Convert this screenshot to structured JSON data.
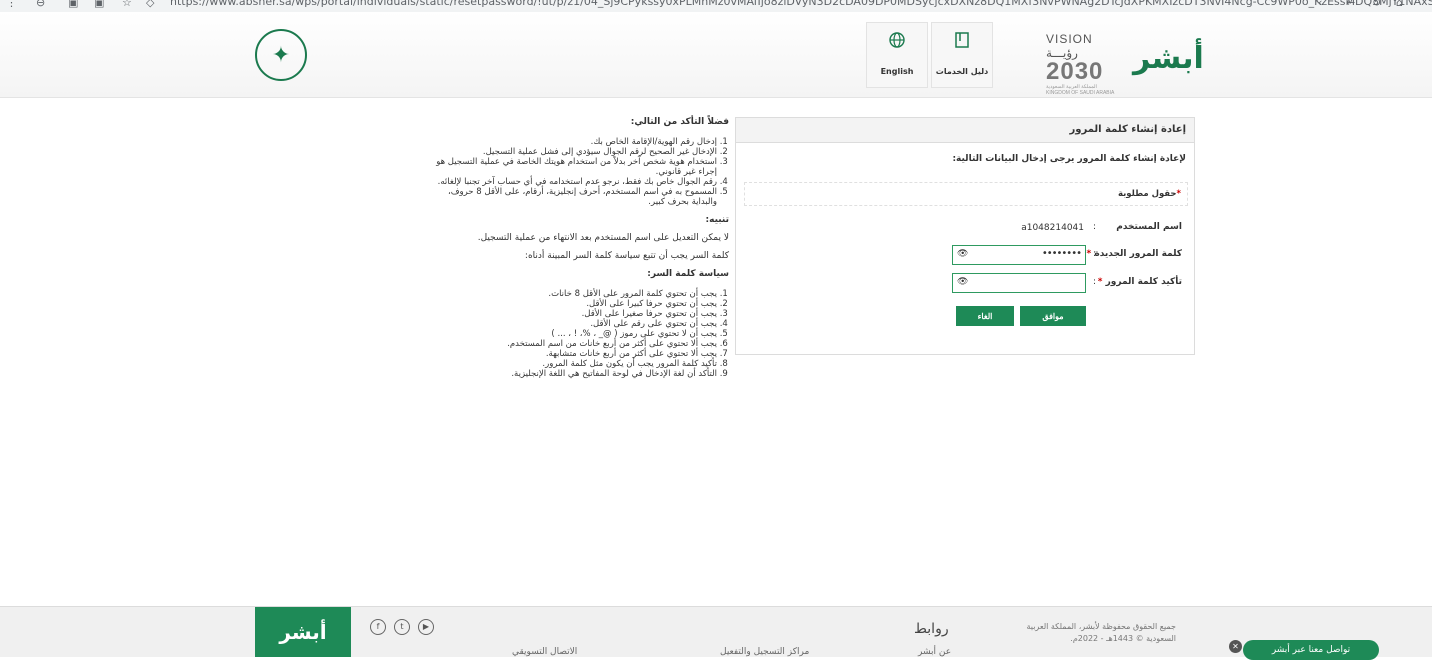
{
  "browser": {
    "url": "https://www.absher.sa/wps/portal/individuals/static/resetpassword/!ut/p/z1/04_Sj9CPykssy0xPLMnMz0vMAfIjo8ziDVyN3D2cDA09DP0MDSycjcxDXNz8DQ1MXf3NvPWNAg2DTcJdXPKMXIzcDT3NvI4Ncg-Cc9WP0o_KzEssMDQ3MjY1NAxSSC4tIk-H2CVBgxw2LqQJvH4Wkmy1Wa/"
  },
  "header": {
    "tiles": [
      {
        "label": "دليل الخدمات",
        "icon": "book-icon"
      },
      {
        "label": "English",
        "icon": "globe-icon"
      }
    ],
    "vision": {
      "line1": "VISION رؤيـــة",
      "year": "2030",
      "sub1": "المملكة العربية السعودية",
      "sub2": "KINGDOM OF SAUDI ARABIA"
    },
    "brand": "أبشر"
  },
  "form": {
    "title": "إعادة إنشاء كلمة المرور",
    "intro": "لإعادة إنشاء كلمة المرور يرجى إدخال البيانات التالية:",
    "required_note": "حقول مطلوبة",
    "username_label": "اسم المستخدم",
    "username_value": "a1048214041",
    "new_password_label": "كلمة المرور الجديدة",
    "new_password_value": "••••••••",
    "confirm_password_label": "تأكيد كلمة المرور",
    "confirm_password_value": "",
    "colon": ":",
    "star": "*",
    "ok_button": "موافق",
    "cancel_button": "الغاء"
  },
  "instructions": {
    "check_title": "فضلاً التأكد من التالي:",
    "check_items": [
      "إدخال رقم الهوية/الإقامة الخاص بك.",
      "الإدخال غير الصحيح لرقم الجوال سيؤدي إلى فشل عملية التسجيل.",
      "استخدام هوية شخص آخر بدلاً من استخدام هويتك الخاصة في عملية التسجيل هو إجراء غير قانوني.",
      "رقم الجوال خاص بك فقط، نرجو عدم استخدامه في أي حساب آخر تجنبا لإلغائه.",
      "المسموح به في اسم المستخدم، أحرف إنجليزية، أرقام، على الأقل 8 حروف، والبداية بحرف كبير."
    ],
    "note_title": "تنبيه:",
    "note_text1": "لا يمكن التعديل على اسم المستخدم بعد الانتهاء من عملية التسجيل.",
    "note_text2": "كلمة السر يجب أن تتبع سياسة كلمة السر المبينة أدناه:",
    "policy_title": "سياسة كلمة السر:",
    "policy_items": [
      "يجب أن تحتوي كلمة المرور على الأقل 8 خانات.",
      "يجب أن تحتوي حرفا كبيرا على الأقل.",
      "يجب أن تحتوي حرفا صغيرا على الأقل.",
      "يجب أن تحتوي على رقم على الأقل.",
      "يجب أن لا تحتوي على رموز ( @_ ، %، ! ، ... )",
      "يجب ألا تحتوي على أكثر من أربع خانات من اسم المستخدم.",
      "يجب ألا تحتوي على أكثر من أربع خانات متشابهة.",
      "تأكيد كلمة المرور يجب أن يكون مثل كلمة المرور.",
      "التأكد أن لغة الإدخال في لوحة المفاتيح هي اللغة الإنجليزية."
    ]
  },
  "footer": {
    "links_title": "روابط",
    "copyright": "جميع الحقوق محفوظة لأبشر، المملكة العربية السعودية © 1443هـ - 2022م.",
    "link1": "عن أبشر",
    "link2": "مراكز التسجيل والتفعيل",
    "link3": "الاتصال التسويقي",
    "social": [
      "f",
      "t",
      "▶"
    ],
    "chat_label": "تواصل معنا عبر أبشر",
    "chat_close": "✕",
    "brand": "أبشر"
  }
}
